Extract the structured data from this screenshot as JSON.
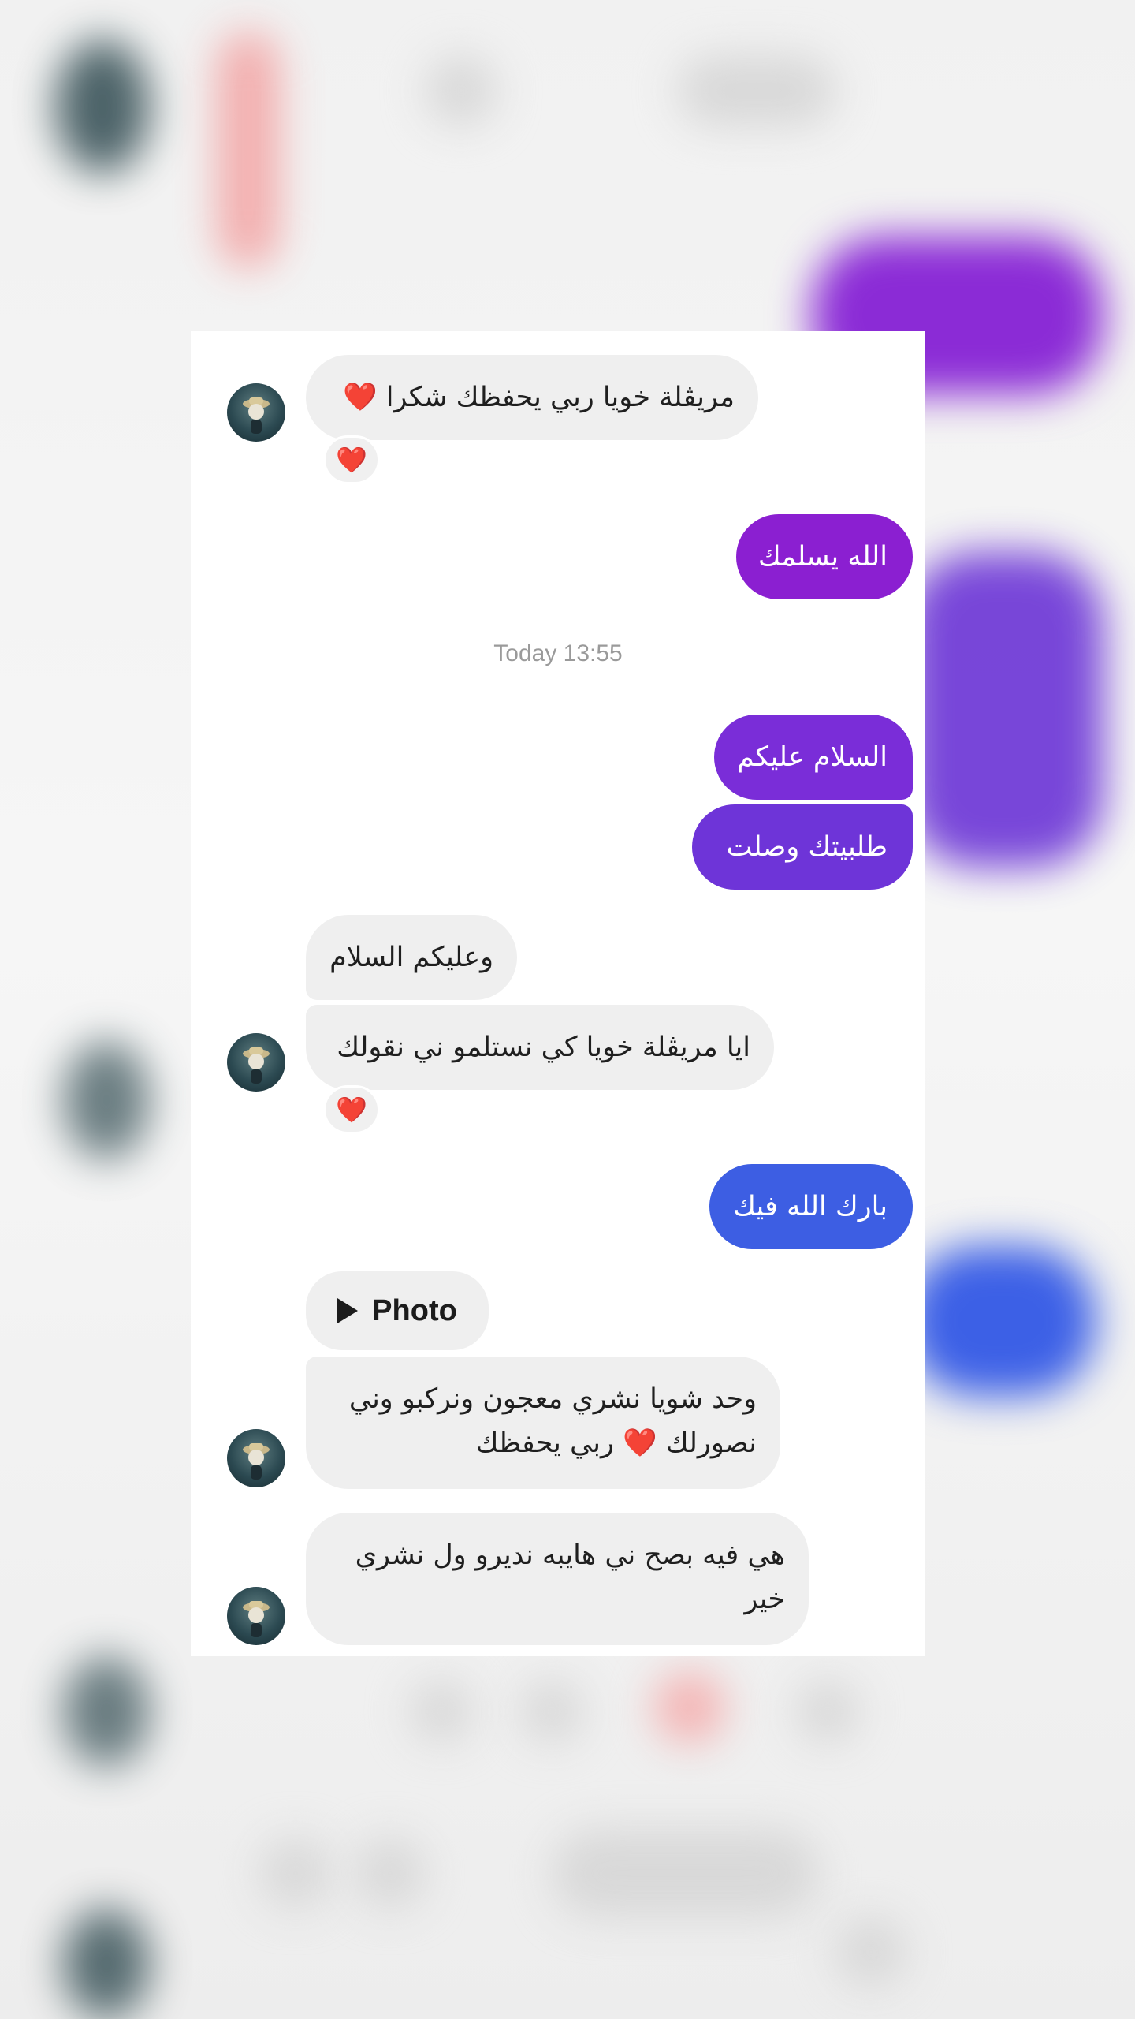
{
  "thread": {
    "messages": [
      {
        "from": "contact",
        "text": "مريڨلة خويا ربي يحفظك شكرا",
        "emoji": "❤️",
        "reaction": "❤️"
      },
      {
        "from": "me",
        "text": "الله يسلمك"
      },
      {
        "from": "me",
        "text": "السلام عليكم"
      },
      {
        "from": "me",
        "text": "طلبيتك وصلت"
      },
      {
        "from": "contact",
        "text": "وعليكم السلام"
      },
      {
        "from": "contact",
        "text": "ايا مريڨلة خويا كي نستلمو ني نقولك",
        "reaction": "❤️"
      },
      {
        "from": "me",
        "text": "بارك الله فيك"
      },
      {
        "from": "contact",
        "line1": "وحد شويا نشري معجون ونركبو وني",
        "line2": "نصورلك",
        "emoji": "❤️",
        "line2_end": "ربي يحفظك"
      },
      {
        "from": "contact",
        "line1": "هي فيه بصح ني هايبه نديرو ول نشري",
        "line2": "خير"
      }
    ],
    "timestamp": "Today 13:55",
    "photo_label": "Photo"
  },
  "colors": {
    "incoming_bubble": "#efefef",
    "outgoing_purple": "#8b1fd1",
    "outgoing_violet": "#6e34d8",
    "outgoing_blue": "#3d5ee3",
    "heart": "#e8253b"
  },
  "icons": {
    "avatar": "profile-avatar",
    "reaction": "heart-reaction-icon",
    "photo": "play-icon"
  }
}
